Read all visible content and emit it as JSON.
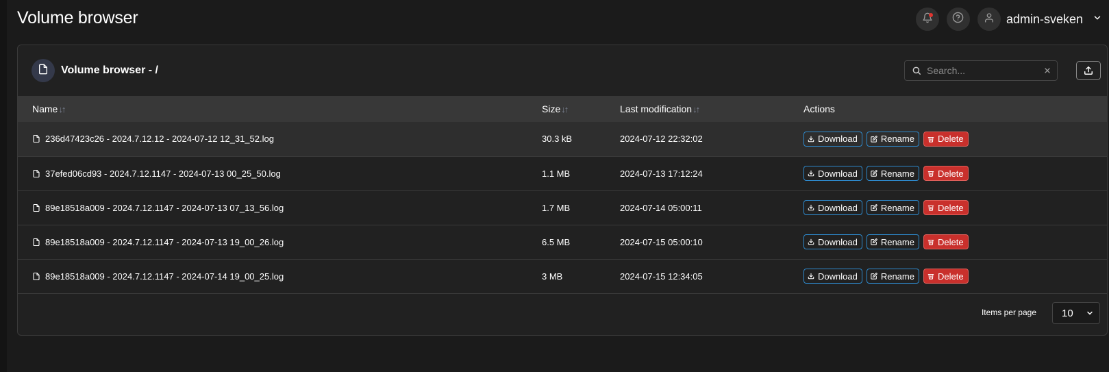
{
  "header": {
    "title": "Volume browser",
    "user_name": "admin-sveken"
  },
  "card": {
    "title": "Volume browser - /",
    "search_placeholder": "Search..."
  },
  "table": {
    "columns": [
      {
        "label": "Name",
        "sortable": true
      },
      {
        "label": "Size",
        "sortable": true
      },
      {
        "label": "Last modification",
        "sortable": true
      },
      {
        "label": "Actions",
        "sortable": false
      }
    ],
    "actions": {
      "download": "Download",
      "rename": "Rename",
      "delete": "Delete"
    },
    "rows": [
      {
        "name": "236d47423c26 - 2024.7.12.12 - 2024-07-12 12_31_52.log",
        "size": "30.3 kB",
        "modified": "2024-07-12 22:32:02"
      },
      {
        "name": "37efed06cd93 - 2024.7.12.1147 - 2024-07-13 00_25_50.log",
        "size": "1.1 MB",
        "modified": "2024-07-13 17:12:24"
      },
      {
        "name": "89e18518a009 - 2024.7.12.1147 - 2024-07-13 07_13_56.log",
        "size": "1.7 MB",
        "modified": "2024-07-14 05:00:11"
      },
      {
        "name": "89e18518a009 - 2024.7.12.1147 - 2024-07-13 19_00_26.log",
        "size": "6.5 MB",
        "modified": "2024-07-15 05:00:10"
      },
      {
        "name": "89e18518a009 - 2024.7.12.1147 - 2024-07-14 19_00_25.log",
        "size": "3 MB",
        "modified": "2024-07-15 12:34:05"
      }
    ]
  },
  "pagination": {
    "items_per_page_label": "Items per page",
    "items_per_page_value": "10"
  },
  "colors": {
    "background": "#1b1b1b",
    "card": "#212121",
    "table_header": "#383838",
    "accent_blue": "#2e8bcf",
    "danger_red": "#c9302c",
    "notification_dot": "#e0342f"
  },
  "icons": {
    "notifications": "bell-icon",
    "help": "help-circle-icon",
    "user": "user-icon",
    "user_menu": "chevron-down-icon",
    "card": "file-icon",
    "search": "search-icon",
    "clear_search": "close-icon",
    "upload": "upload-icon",
    "row_file": "file-icon",
    "download": "download-icon",
    "rename": "edit-icon",
    "delete": "trash-icon"
  }
}
